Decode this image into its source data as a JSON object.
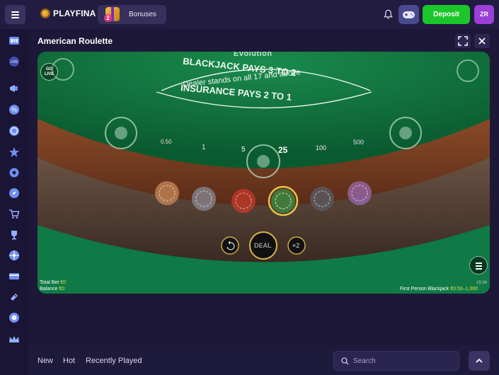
{
  "header": {
    "brand": "PLAYFINA",
    "bonuses_label": "Bonuses",
    "bonuses_count": "2",
    "deposit_label": "Deposit",
    "avatar_initials": "ZR"
  },
  "sidebar": {
    "items": [
      {
        "icon": "slot-machine-icon"
      },
      {
        "icon": "live-icon",
        "label": "LIVE"
      },
      {
        "icon": "megaphone-icon"
      },
      {
        "icon": "percent-icon"
      },
      {
        "icon": "coin-icon"
      },
      {
        "icon": "star-icon"
      },
      {
        "icon": "gear-icon"
      },
      {
        "icon": "compass-icon"
      },
      {
        "icon": "cart-icon"
      },
      {
        "icon": "trophy-icon"
      },
      {
        "icon": "wheel-icon"
      },
      {
        "icon": "cash-icon"
      },
      {
        "icon": "ticket-icon"
      },
      {
        "icon": "badge-icon"
      },
      {
        "icon": "crown-icon"
      }
    ]
  },
  "game": {
    "title": "American Roulette",
    "provider": "Evolution",
    "go_live": "GO LIVE",
    "table_line1": "BLACKJACK PAYS 3 TO 2",
    "table_line2": "Dealer stands on all 17 and above",
    "table_line3": "INSURANCE PAYS 2 TO 1",
    "chips": [
      "0.50",
      "1",
      "5",
      "25",
      "100",
      "500"
    ],
    "deal_label": "DEAL",
    "double_label": "×2",
    "total_bet_label": "Total Bet",
    "total_bet_value": "€0",
    "balance_label": "Balance",
    "balance_value": "€0",
    "time": "15:04",
    "game_name": "First Person Blackjack",
    "limits": "€0.50–1,000"
  },
  "footer": {
    "tabs": [
      "New",
      "Hot",
      "Recently Played"
    ],
    "search_placeholder": "Search"
  },
  "colors": {
    "accent_green": "#1bc62b",
    "avatar_purple": "#9b3fd6",
    "table_felt": "#0f6b3a",
    "background": "#1d1838"
  }
}
